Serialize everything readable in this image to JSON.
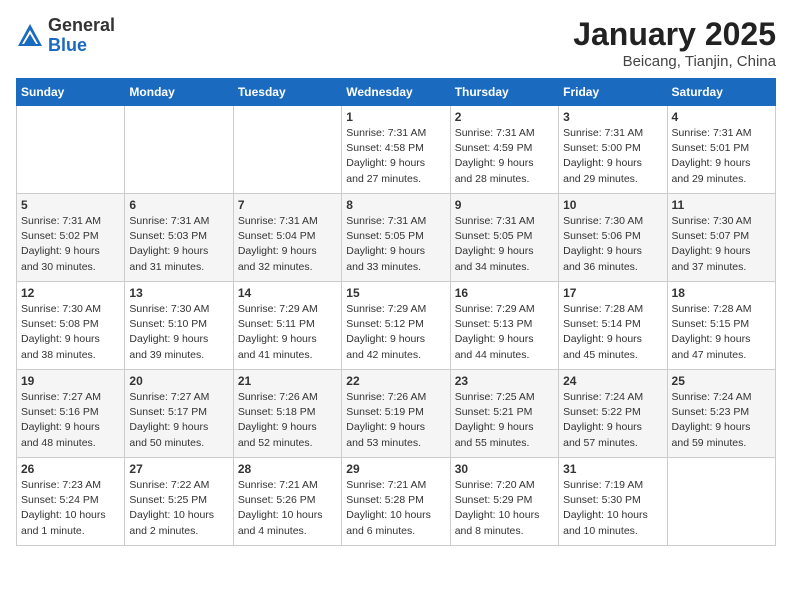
{
  "logo": {
    "general": "General",
    "blue": "Blue"
  },
  "title": "January 2025",
  "subtitle": "Beicang, Tianjin, China",
  "days_of_week": [
    "Sunday",
    "Monday",
    "Tuesday",
    "Wednesday",
    "Thursday",
    "Friday",
    "Saturday"
  ],
  "weeks": [
    [
      {
        "day": "",
        "info": ""
      },
      {
        "day": "",
        "info": ""
      },
      {
        "day": "",
        "info": ""
      },
      {
        "day": "1",
        "info": "Sunrise: 7:31 AM\nSunset: 4:58 PM\nDaylight: 9 hours\nand 27 minutes."
      },
      {
        "day": "2",
        "info": "Sunrise: 7:31 AM\nSunset: 4:59 PM\nDaylight: 9 hours\nand 28 minutes."
      },
      {
        "day": "3",
        "info": "Sunrise: 7:31 AM\nSunset: 5:00 PM\nDaylight: 9 hours\nand 29 minutes."
      },
      {
        "day": "4",
        "info": "Sunrise: 7:31 AM\nSunset: 5:01 PM\nDaylight: 9 hours\nand 29 minutes."
      }
    ],
    [
      {
        "day": "5",
        "info": "Sunrise: 7:31 AM\nSunset: 5:02 PM\nDaylight: 9 hours\nand 30 minutes."
      },
      {
        "day": "6",
        "info": "Sunrise: 7:31 AM\nSunset: 5:03 PM\nDaylight: 9 hours\nand 31 minutes."
      },
      {
        "day": "7",
        "info": "Sunrise: 7:31 AM\nSunset: 5:04 PM\nDaylight: 9 hours\nand 32 minutes."
      },
      {
        "day": "8",
        "info": "Sunrise: 7:31 AM\nSunset: 5:05 PM\nDaylight: 9 hours\nand 33 minutes."
      },
      {
        "day": "9",
        "info": "Sunrise: 7:31 AM\nSunset: 5:05 PM\nDaylight: 9 hours\nand 34 minutes."
      },
      {
        "day": "10",
        "info": "Sunrise: 7:30 AM\nSunset: 5:06 PM\nDaylight: 9 hours\nand 36 minutes."
      },
      {
        "day": "11",
        "info": "Sunrise: 7:30 AM\nSunset: 5:07 PM\nDaylight: 9 hours\nand 37 minutes."
      }
    ],
    [
      {
        "day": "12",
        "info": "Sunrise: 7:30 AM\nSunset: 5:08 PM\nDaylight: 9 hours\nand 38 minutes."
      },
      {
        "day": "13",
        "info": "Sunrise: 7:30 AM\nSunset: 5:10 PM\nDaylight: 9 hours\nand 39 minutes."
      },
      {
        "day": "14",
        "info": "Sunrise: 7:29 AM\nSunset: 5:11 PM\nDaylight: 9 hours\nand 41 minutes."
      },
      {
        "day": "15",
        "info": "Sunrise: 7:29 AM\nSunset: 5:12 PM\nDaylight: 9 hours\nand 42 minutes."
      },
      {
        "day": "16",
        "info": "Sunrise: 7:29 AM\nSunset: 5:13 PM\nDaylight: 9 hours\nand 44 minutes."
      },
      {
        "day": "17",
        "info": "Sunrise: 7:28 AM\nSunset: 5:14 PM\nDaylight: 9 hours\nand 45 minutes."
      },
      {
        "day": "18",
        "info": "Sunrise: 7:28 AM\nSunset: 5:15 PM\nDaylight: 9 hours\nand 47 minutes."
      }
    ],
    [
      {
        "day": "19",
        "info": "Sunrise: 7:27 AM\nSunset: 5:16 PM\nDaylight: 9 hours\nand 48 minutes."
      },
      {
        "day": "20",
        "info": "Sunrise: 7:27 AM\nSunset: 5:17 PM\nDaylight: 9 hours\nand 50 minutes."
      },
      {
        "day": "21",
        "info": "Sunrise: 7:26 AM\nSunset: 5:18 PM\nDaylight: 9 hours\nand 52 minutes."
      },
      {
        "day": "22",
        "info": "Sunrise: 7:26 AM\nSunset: 5:19 PM\nDaylight: 9 hours\nand 53 minutes."
      },
      {
        "day": "23",
        "info": "Sunrise: 7:25 AM\nSunset: 5:21 PM\nDaylight: 9 hours\nand 55 minutes."
      },
      {
        "day": "24",
        "info": "Sunrise: 7:24 AM\nSunset: 5:22 PM\nDaylight: 9 hours\nand 57 minutes."
      },
      {
        "day": "25",
        "info": "Sunrise: 7:24 AM\nSunset: 5:23 PM\nDaylight: 9 hours\nand 59 minutes."
      }
    ],
    [
      {
        "day": "26",
        "info": "Sunrise: 7:23 AM\nSunset: 5:24 PM\nDaylight: 10 hours\nand 1 minute."
      },
      {
        "day": "27",
        "info": "Sunrise: 7:22 AM\nSunset: 5:25 PM\nDaylight: 10 hours\nand 2 minutes."
      },
      {
        "day": "28",
        "info": "Sunrise: 7:21 AM\nSunset: 5:26 PM\nDaylight: 10 hours\nand 4 minutes."
      },
      {
        "day": "29",
        "info": "Sunrise: 7:21 AM\nSunset: 5:28 PM\nDaylight: 10 hours\nand 6 minutes."
      },
      {
        "day": "30",
        "info": "Sunrise: 7:20 AM\nSunset: 5:29 PM\nDaylight: 10 hours\nand 8 minutes."
      },
      {
        "day": "31",
        "info": "Sunrise: 7:19 AM\nSunset: 5:30 PM\nDaylight: 10 hours\nand 10 minutes."
      },
      {
        "day": "",
        "info": ""
      }
    ]
  ]
}
